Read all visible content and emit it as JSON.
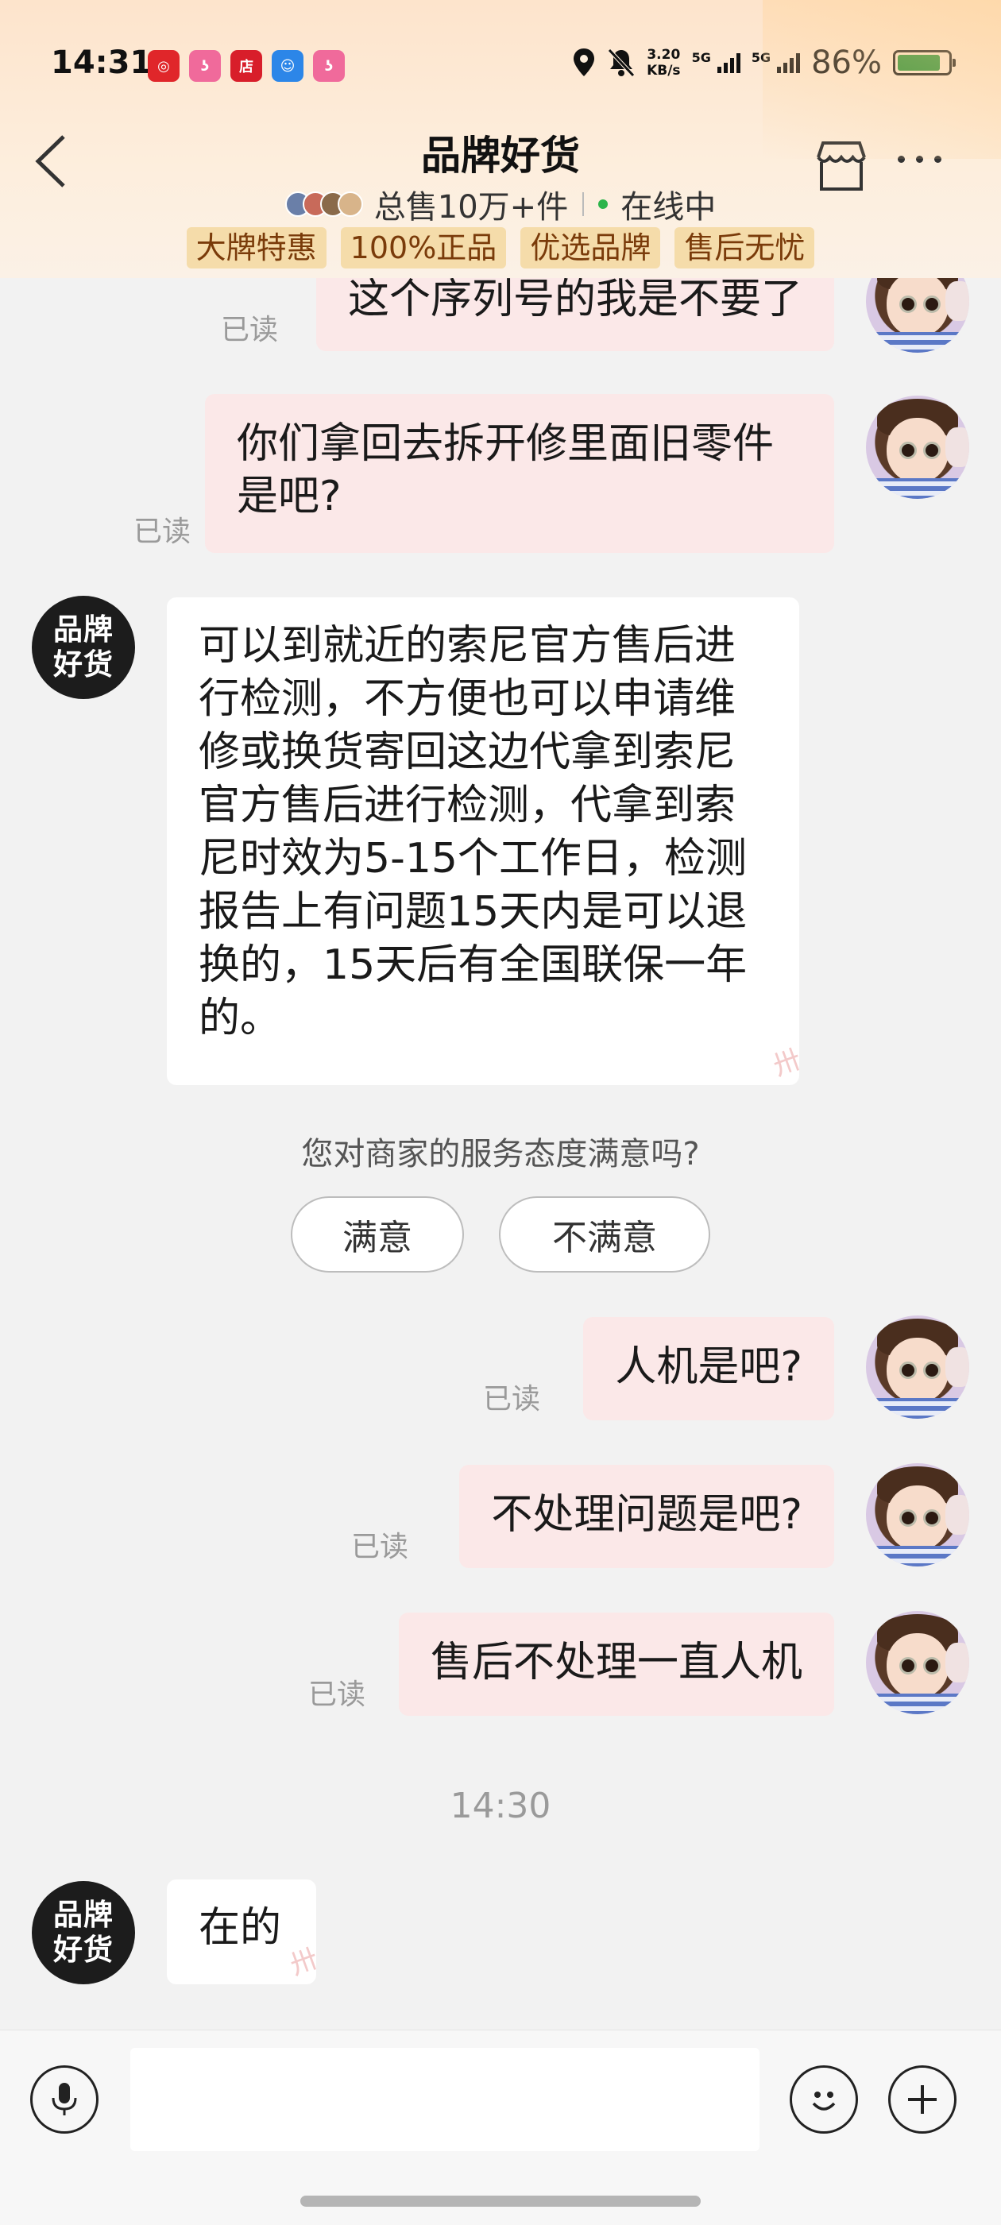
{
  "status_bar": {
    "time": "14:31",
    "net_speed_top": "3.20",
    "net_speed_bottom": "KB/s",
    "sim1": "5G",
    "sim2": "5G",
    "battery": "86%",
    "battery_level": 0.86,
    "app_icons": [
      {
        "name": "netease-music-icon",
        "color": "#e0262a",
        "glyph": "◎"
      },
      {
        "name": "bilibili-icon-1",
        "color": "#f06a9b",
        "glyph": "ʖ"
      },
      {
        "name": "dian-app-icon",
        "color": "#d81e2a",
        "glyph": "店"
      },
      {
        "name": "robot-app-icon",
        "color": "#2c86e8",
        "glyph": "☺"
      },
      {
        "name": "bilibili-icon-2",
        "color": "#f06a9b",
        "glyph": "ʖ"
      }
    ]
  },
  "header": {
    "title": "品牌好货",
    "sales": "总售10万+件",
    "online": "在线中",
    "tags": [
      "大牌特惠",
      "100%正品",
      "优选品牌",
      "售后无忧"
    ]
  },
  "shop_avatar": {
    "line1": "品牌",
    "line2": "好货"
  },
  "read_label": "已读",
  "messages": {
    "m1": "这个序列号的我是不要了",
    "m2_l1": "你们拿回去拆开修里面旧零件",
    "m2_l2": "是吧?",
    "shop_lines": [
      "可以到就近的索尼官方售后进",
      "行检测，不方便也可以申请维",
      "修或换货寄回这边代拿到索尼",
      "官方售后进行检测，代拿到索",
      "尼时效为5-15个工作日，检测",
      "报告上有问题15天内是可以退",
      "换的，15天后有全国联保一年",
      "的。"
    ],
    "m3": "人机是吧?",
    "m4": "不处理问题是吧?",
    "m5": "售后不处理一直人机",
    "shop2": "在的"
  },
  "survey": {
    "question": "您对商家的服务态度满意吗?",
    "satisfied": "满意",
    "unsatisfied": "不满意"
  },
  "timestamp": "14:30",
  "colors": {
    "accent_online": "#2cb44a",
    "bubble_user": "#fbe8e8",
    "bubble_shop": "#ffffff",
    "tag_bg": "#f5dcaa"
  }
}
